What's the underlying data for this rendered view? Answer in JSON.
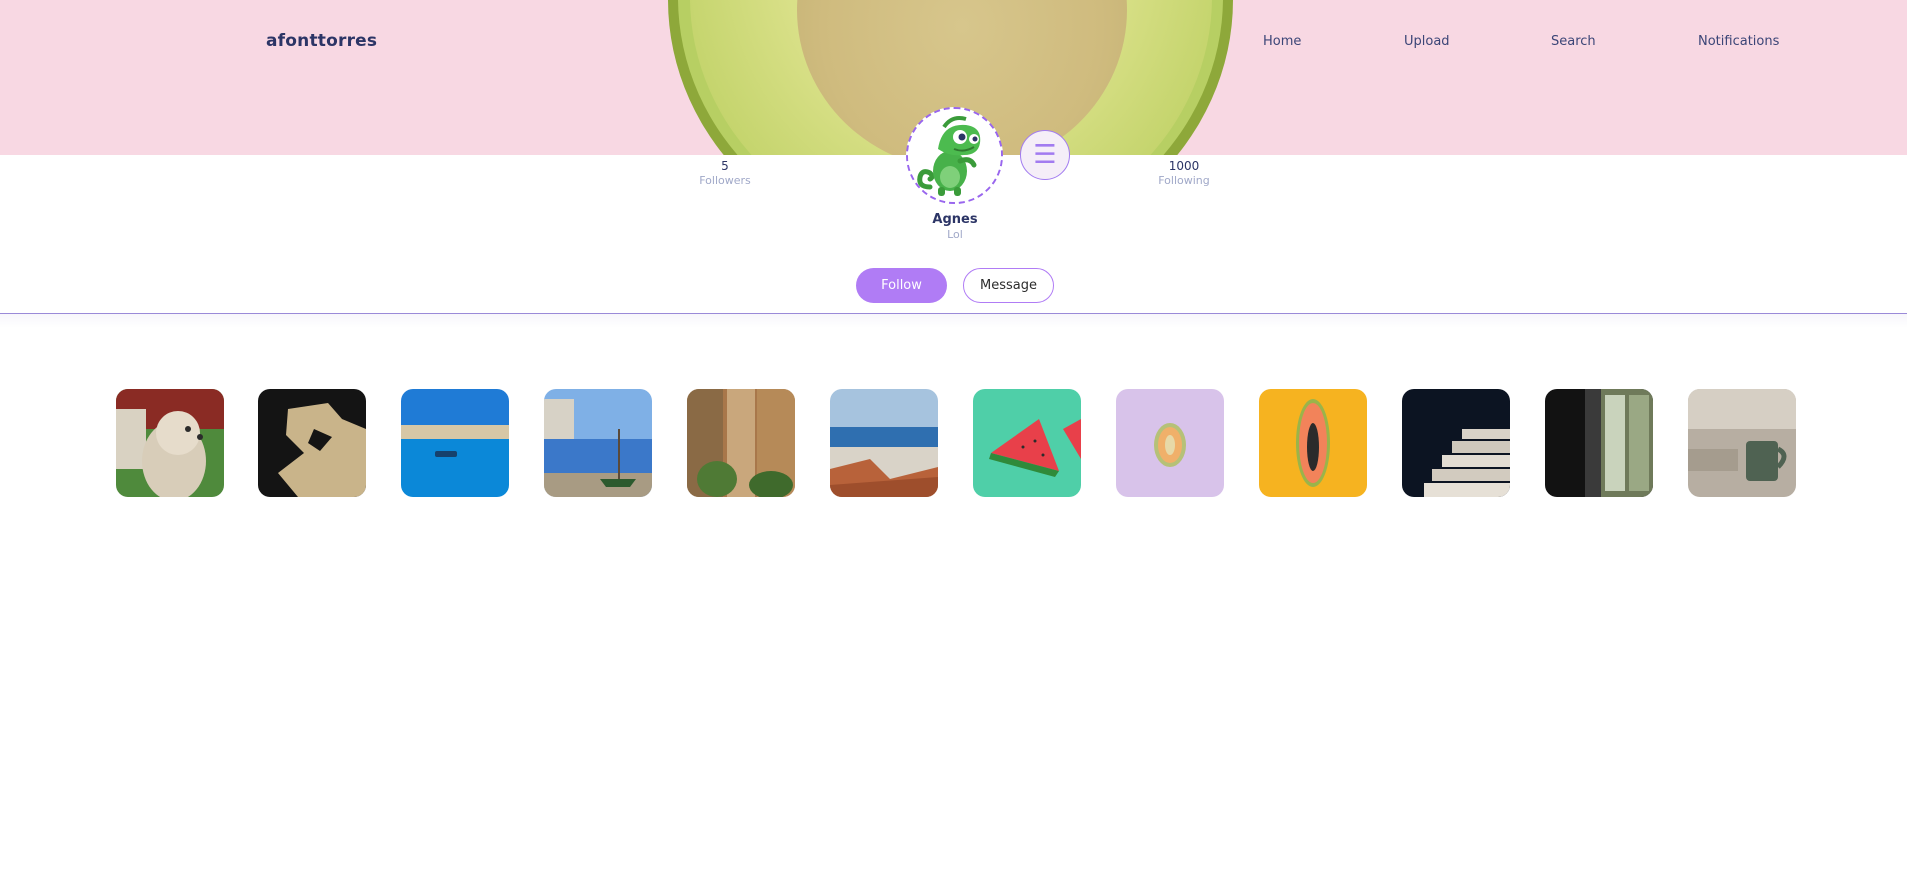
{
  "header": {
    "brand": "afonttorres",
    "nav": {
      "home": "Home",
      "upload": "Upload",
      "search": "Search",
      "notifications": "Notifications"
    }
  },
  "profile": {
    "followers_count": "5",
    "followers_label": "Followers",
    "following_count": "1000",
    "following_label": "Following",
    "name": "Agnes",
    "bio": "Lol",
    "follow_label": "Follow",
    "message_label": "Message",
    "menu_icon": "hamburger-menu-icon"
  },
  "colors": {
    "banner": "#f8d8e3",
    "accent": "#b07cf5",
    "text_dark": "#2c3566",
    "text_muted": "#a0a8c8"
  },
  "gallery": [
    {
      "subject": "dog"
    },
    {
      "subject": "peeling-paint"
    },
    {
      "subject": "harbor-boat"
    },
    {
      "subject": "seaside-street-boat"
    },
    {
      "subject": "stone-alley"
    },
    {
      "subject": "rooftops-bay"
    },
    {
      "subject": "watermelon"
    },
    {
      "subject": "melon-half"
    },
    {
      "subject": "papaya"
    },
    {
      "subject": "stacked-books"
    },
    {
      "subject": "dark-window"
    },
    {
      "subject": "coffee-mug"
    }
  ]
}
